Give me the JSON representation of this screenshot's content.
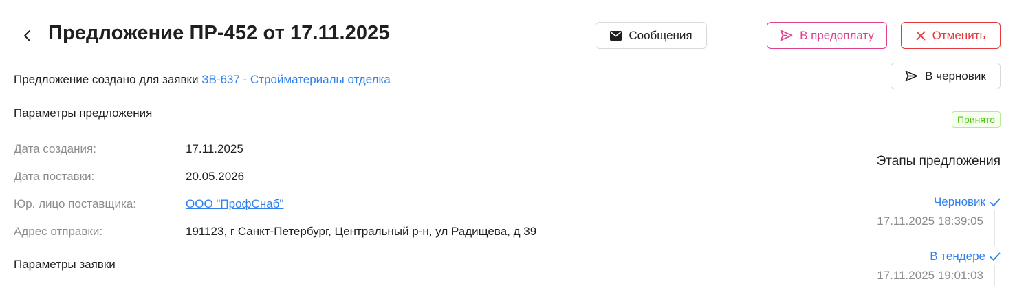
{
  "header": {
    "title": "Предложение ПР-452 от 17.11.2025",
    "messages_label": "Сообщения"
  },
  "actions": {
    "prepay_label": "В предоплату",
    "cancel_label": "Отменить",
    "draft_label": "В черновик"
  },
  "request_info": {
    "prefix": "Предложение создано для заявки",
    "link": "ЗВ-637 - Стройматериалы отделка"
  },
  "offer_params": {
    "title": "Параметры предложения",
    "rows": [
      {
        "label": "Дата создания:",
        "value": "17.11.2025"
      },
      {
        "label": "Дата поставки:",
        "value": "20.05.2026"
      },
      {
        "label": "Юр. лицо поставщика:",
        "value": "ООО \"ПрофСнаб\""
      },
      {
        "label": "Адрес отправки:",
        "value": "191123, г Санкт-Петербург, Центральный р-н, ул Радищева, д 39"
      }
    ]
  },
  "request_params": {
    "title": "Параметры заявки"
  },
  "status": {
    "label": "Принято",
    "color": "#52c41a"
  },
  "stages": {
    "title": "Этапы предложения",
    "items": [
      {
        "name": "Черновик",
        "time": "17.11.2025 18:39:05"
      },
      {
        "name": "В тендере",
        "time": "17.11.2025 19:01:03"
      }
    ]
  },
  "colors": {
    "accent": "#2f80ed",
    "prepay": "#e0418f",
    "cancel": "#e5383b",
    "muted": "#8c8c8c"
  },
  "icons": {
    "back": "chevron-left-icon",
    "messages": "envelope-icon",
    "prepay": "send-icon",
    "cancel": "close-icon",
    "draft": "send-icon",
    "stage_done": "check-icon"
  }
}
